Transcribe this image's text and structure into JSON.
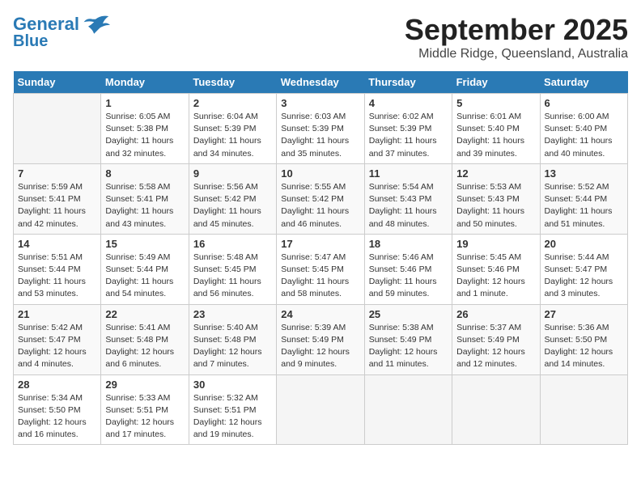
{
  "header": {
    "logo_line1": "General",
    "logo_line2": "Blue",
    "title": "September 2025",
    "subtitle": "Middle Ridge, Queensland, Australia"
  },
  "days_of_week": [
    "Sunday",
    "Monday",
    "Tuesday",
    "Wednesday",
    "Thursday",
    "Friday",
    "Saturday"
  ],
  "weeks": [
    [
      {
        "day": "",
        "sunrise": "",
        "sunset": "",
        "daylight": "",
        "empty": true
      },
      {
        "day": "1",
        "sunrise": "Sunrise: 6:05 AM",
        "sunset": "Sunset: 5:38 PM",
        "daylight": "Daylight: 11 hours and 32 minutes."
      },
      {
        "day": "2",
        "sunrise": "Sunrise: 6:04 AM",
        "sunset": "Sunset: 5:39 PM",
        "daylight": "Daylight: 11 hours and 34 minutes."
      },
      {
        "day": "3",
        "sunrise": "Sunrise: 6:03 AM",
        "sunset": "Sunset: 5:39 PM",
        "daylight": "Daylight: 11 hours and 35 minutes."
      },
      {
        "day": "4",
        "sunrise": "Sunrise: 6:02 AM",
        "sunset": "Sunset: 5:39 PM",
        "daylight": "Daylight: 11 hours and 37 minutes."
      },
      {
        "day": "5",
        "sunrise": "Sunrise: 6:01 AM",
        "sunset": "Sunset: 5:40 PM",
        "daylight": "Daylight: 11 hours and 39 minutes."
      },
      {
        "day": "6",
        "sunrise": "Sunrise: 6:00 AM",
        "sunset": "Sunset: 5:40 PM",
        "daylight": "Daylight: 11 hours and 40 minutes."
      }
    ],
    [
      {
        "day": "7",
        "sunrise": "Sunrise: 5:59 AM",
        "sunset": "Sunset: 5:41 PM",
        "daylight": "Daylight: 11 hours and 42 minutes."
      },
      {
        "day": "8",
        "sunrise": "Sunrise: 5:58 AM",
        "sunset": "Sunset: 5:41 PM",
        "daylight": "Daylight: 11 hours and 43 minutes."
      },
      {
        "day": "9",
        "sunrise": "Sunrise: 5:56 AM",
        "sunset": "Sunset: 5:42 PM",
        "daylight": "Daylight: 11 hours and 45 minutes."
      },
      {
        "day": "10",
        "sunrise": "Sunrise: 5:55 AM",
        "sunset": "Sunset: 5:42 PM",
        "daylight": "Daylight: 11 hours and 46 minutes."
      },
      {
        "day": "11",
        "sunrise": "Sunrise: 5:54 AM",
        "sunset": "Sunset: 5:43 PM",
        "daylight": "Daylight: 11 hours and 48 minutes."
      },
      {
        "day": "12",
        "sunrise": "Sunrise: 5:53 AM",
        "sunset": "Sunset: 5:43 PM",
        "daylight": "Daylight: 11 hours and 50 minutes."
      },
      {
        "day": "13",
        "sunrise": "Sunrise: 5:52 AM",
        "sunset": "Sunset: 5:44 PM",
        "daylight": "Daylight: 11 hours and 51 minutes."
      }
    ],
    [
      {
        "day": "14",
        "sunrise": "Sunrise: 5:51 AM",
        "sunset": "Sunset: 5:44 PM",
        "daylight": "Daylight: 11 hours and 53 minutes."
      },
      {
        "day": "15",
        "sunrise": "Sunrise: 5:49 AM",
        "sunset": "Sunset: 5:44 PM",
        "daylight": "Daylight: 11 hours and 54 minutes."
      },
      {
        "day": "16",
        "sunrise": "Sunrise: 5:48 AM",
        "sunset": "Sunset: 5:45 PM",
        "daylight": "Daylight: 11 hours and 56 minutes."
      },
      {
        "day": "17",
        "sunrise": "Sunrise: 5:47 AM",
        "sunset": "Sunset: 5:45 PM",
        "daylight": "Daylight: 11 hours and 58 minutes."
      },
      {
        "day": "18",
        "sunrise": "Sunrise: 5:46 AM",
        "sunset": "Sunset: 5:46 PM",
        "daylight": "Daylight: 11 hours and 59 minutes."
      },
      {
        "day": "19",
        "sunrise": "Sunrise: 5:45 AM",
        "sunset": "Sunset: 5:46 PM",
        "daylight": "Daylight: 12 hours and 1 minute."
      },
      {
        "day": "20",
        "sunrise": "Sunrise: 5:44 AM",
        "sunset": "Sunset: 5:47 PM",
        "daylight": "Daylight: 12 hours and 3 minutes."
      }
    ],
    [
      {
        "day": "21",
        "sunrise": "Sunrise: 5:42 AM",
        "sunset": "Sunset: 5:47 PM",
        "daylight": "Daylight: 12 hours and 4 minutes."
      },
      {
        "day": "22",
        "sunrise": "Sunrise: 5:41 AM",
        "sunset": "Sunset: 5:48 PM",
        "daylight": "Daylight: 12 hours and 6 minutes."
      },
      {
        "day": "23",
        "sunrise": "Sunrise: 5:40 AM",
        "sunset": "Sunset: 5:48 PM",
        "daylight": "Daylight: 12 hours and 7 minutes."
      },
      {
        "day": "24",
        "sunrise": "Sunrise: 5:39 AM",
        "sunset": "Sunset: 5:49 PM",
        "daylight": "Daylight: 12 hours and 9 minutes."
      },
      {
        "day": "25",
        "sunrise": "Sunrise: 5:38 AM",
        "sunset": "Sunset: 5:49 PM",
        "daylight": "Daylight: 12 hours and 11 minutes."
      },
      {
        "day": "26",
        "sunrise": "Sunrise: 5:37 AM",
        "sunset": "Sunset: 5:49 PM",
        "daylight": "Daylight: 12 hours and 12 minutes."
      },
      {
        "day": "27",
        "sunrise": "Sunrise: 5:36 AM",
        "sunset": "Sunset: 5:50 PM",
        "daylight": "Daylight: 12 hours and 14 minutes."
      }
    ],
    [
      {
        "day": "28",
        "sunrise": "Sunrise: 5:34 AM",
        "sunset": "Sunset: 5:50 PM",
        "daylight": "Daylight: 12 hours and 16 minutes."
      },
      {
        "day": "29",
        "sunrise": "Sunrise: 5:33 AM",
        "sunset": "Sunset: 5:51 PM",
        "daylight": "Daylight: 12 hours and 17 minutes."
      },
      {
        "day": "30",
        "sunrise": "Sunrise: 5:32 AM",
        "sunset": "Sunset: 5:51 PM",
        "daylight": "Daylight: 12 hours and 19 minutes."
      },
      {
        "day": "",
        "sunrise": "",
        "sunset": "",
        "daylight": "",
        "empty": true
      },
      {
        "day": "",
        "sunrise": "",
        "sunset": "",
        "daylight": "",
        "empty": true
      },
      {
        "day": "",
        "sunrise": "",
        "sunset": "",
        "daylight": "",
        "empty": true
      },
      {
        "day": "",
        "sunrise": "",
        "sunset": "",
        "daylight": "",
        "empty": true
      }
    ]
  ]
}
